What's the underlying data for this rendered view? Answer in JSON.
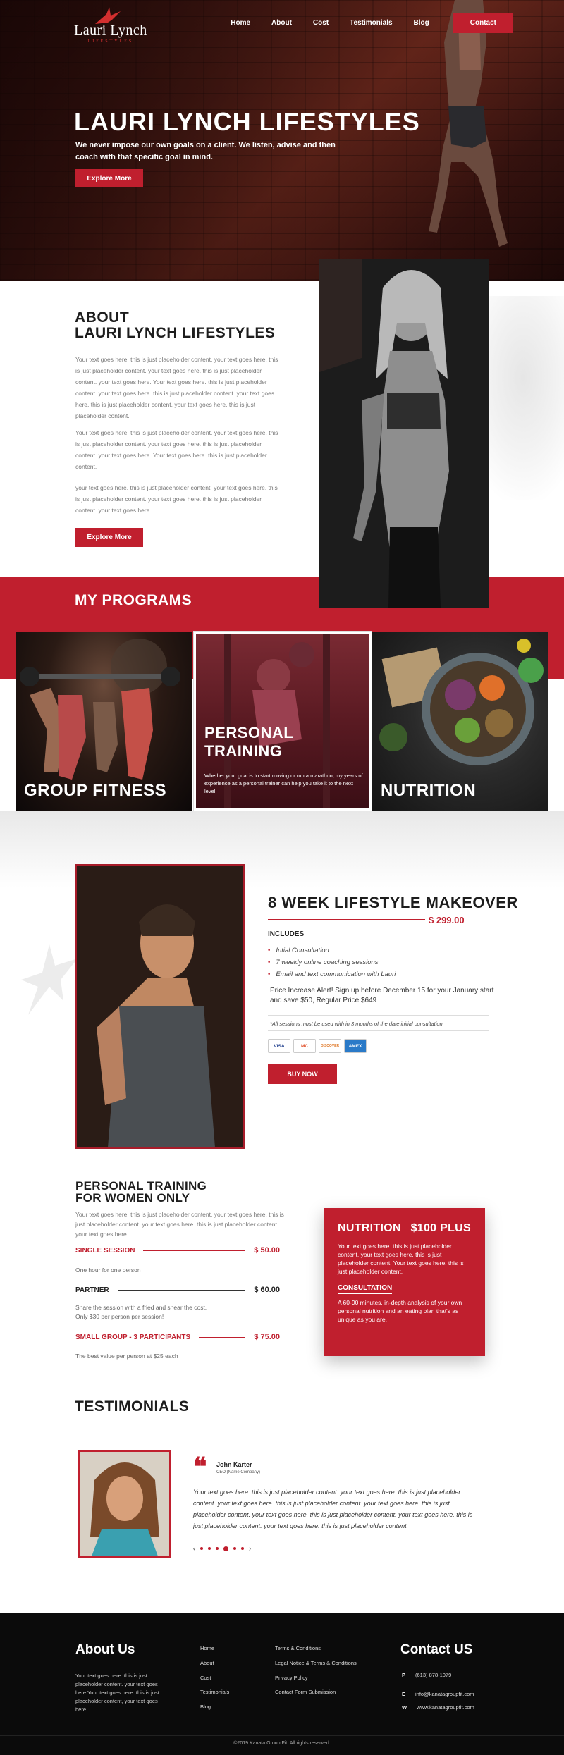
{
  "hero": {
    "logo_name": "Lauri Lynch",
    "logo_sub": "LIFESTYLES",
    "nav": [
      "Home",
      "About",
      "Cost",
      "Testimonials",
      "Blog"
    ],
    "nav_contact": "Contact",
    "title": "LAURI LYNCH LIFESTYLES",
    "subtitle": "We never impose our own goals on a client. We listen, advise and then coach with that specific goal in mind.",
    "button": "Explore More"
  },
  "about": {
    "title_line1": "ABOUT",
    "title_line2": "LAURI LYNCH LIFESTYLES",
    "p1": "Your text goes here. this is just placeholder content. your text goes here. this is just placeholder content. your text goes here. this is just placeholder content. your text goes here. Your text goes here. this is just placeholder content. your text goes here. this is just placeholder content. your text goes here.   this is just placeholder content. your text goes here.   this is just placeholder content.",
    "p2": "Your text goes here. this is just placeholder content. your text goes here. this is just placeholder content. your text goes here. this is just placeholder content. your text goes here. Your text goes here. this is just placeholder content.",
    "p3": "your text goes here. this is just placeholder content. your text goes here.   this is just placeholder content. your text goes here.   this is just placeholder content. your text goes here.",
    "button": "Explore More"
  },
  "programs": {
    "title": "MY PROGRAMS",
    "cards": [
      {
        "label": "GROUP FITNESS"
      },
      {
        "label": "PERSONAL TRAINING",
        "desc": "Whether your goal is to start moving or run a marathon, my years of experience as a personal trainer can help you take it to the next level."
      },
      {
        "label": "NUTRITION"
      }
    ]
  },
  "makeover": {
    "title": "8 WEEK LIFESTYLE MAKEOVER",
    "price": "$ 299.00",
    "includes": "INCLUDES",
    "items": [
      "Intial Consultation",
      "7 weekly online coaching sessions",
      "Email and text communication with Lauri"
    ],
    "alert": "Price Increase Alert! Sign up before December 15 for your January start and save $50, Regular Price $649",
    "note": "*All sessions must be used with in 3 months of the date initial consultation.",
    "cards": [
      "VISA",
      "MC",
      "DISCOVER",
      "AMEX"
    ],
    "button": "BUY NOW"
  },
  "personal_training": {
    "title_line1": "PERSONAL TRAINING",
    "title_line2": "FOR WOMEN ONLY",
    "intro": "Your text goes here. this is just placeholder content. your text goes here. this is just placeholder content. your text goes here. this is just placeholder content. your text goes here.",
    "rows": [
      {
        "name": "SINGLE SESSION",
        "price": "$ 50.00",
        "desc1": "One hour for one person",
        "desc2": ""
      },
      {
        "name": "PARTNER",
        "price": "$ 60.00",
        "desc1": "Share the session with a fried and shear the cost.",
        "desc2": "Only $30 per person per session!"
      },
      {
        "name": "SMALL GROUP - 3 PARTICIPANTS",
        "price": "$ 75.00",
        "desc1": "The best value per person at $25 each",
        "desc2": ""
      }
    ]
  },
  "nutrition_box": {
    "title": "NUTRITION",
    "price": "$100 PLUS",
    "text1": "Your text goes here. this is just placeholder content. your text goes here. this is just placeholder content. Your text goes here. this is just placeholder content.",
    "heading": "CONSULTATION",
    "text2": "A 60-90 minutes, in-depth analysis of your own personal nutrition and an eating plan that's as unique as you are."
  },
  "testimonials": {
    "title": "TESTIMONIALS",
    "quote_mark": "❝",
    "name": "John Karter",
    "company": "CEO (Name Company)",
    "text": "Your text goes here. this is just placeholder content. your text goes here. this is just placeholder content. your text goes here. this is just placeholder content. your text goes here. this is just placeholder content. your text goes here. this is just placeholder content. your text goes here. this is just placeholder content. your text goes here.   this is just placeholder content."
  },
  "footer": {
    "about_title": "About Us",
    "about_text": "Your text goes here. this is just placeholder content. your text goes here Your text goes here. this is just placeholder content, your text goes here.",
    "links1": [
      "Home",
      "About",
      "Cost",
      "Testimonials",
      "Blog"
    ],
    "links2": [
      "Terms & Conditions",
      "Legal Notice & Terms & Conditions",
      "Privacy Policy",
      "Contact Form Submission"
    ],
    "contact_title": "Contact US",
    "contact": [
      {
        "k": "P",
        "v": "(613) 878-1079"
      },
      {
        "k": "E",
        "v": "info@kanatagroupfit.com"
      },
      {
        "k": "W",
        "v": "www.kanatagroupfit.com"
      }
    ],
    "copyright": "©2019 Kanata Group Fit. All rights reserved."
  },
  "colors": {
    "accent": "#c01f2e",
    "dark": "#0b0b0b"
  }
}
